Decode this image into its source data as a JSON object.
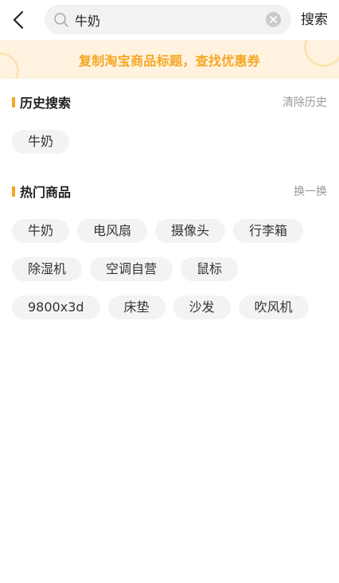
{
  "header": {
    "search_value": "牛奶",
    "search_button": "搜索"
  },
  "banner": {
    "text": "复制淘宝商品标题，查找优惠券"
  },
  "history": {
    "title": "历史搜索",
    "action": "清除历史",
    "items": [
      "牛奶"
    ]
  },
  "hot": {
    "title": "热门商品",
    "action": "换一换",
    "items": [
      "牛奶",
      "电风扇",
      "摄像头",
      "行李箱",
      "除湿机",
      "空调自营",
      "鼠标",
      "9800x3d",
      "床垫",
      "沙发",
      "吹风机"
    ]
  },
  "colors": {
    "accent": "#f5a623",
    "banner_bg": "#fff3e0",
    "tag_bg": "#f3f3f3"
  },
  "icons": [
    "back-arrow-icon",
    "search-icon",
    "clear-icon"
  ]
}
